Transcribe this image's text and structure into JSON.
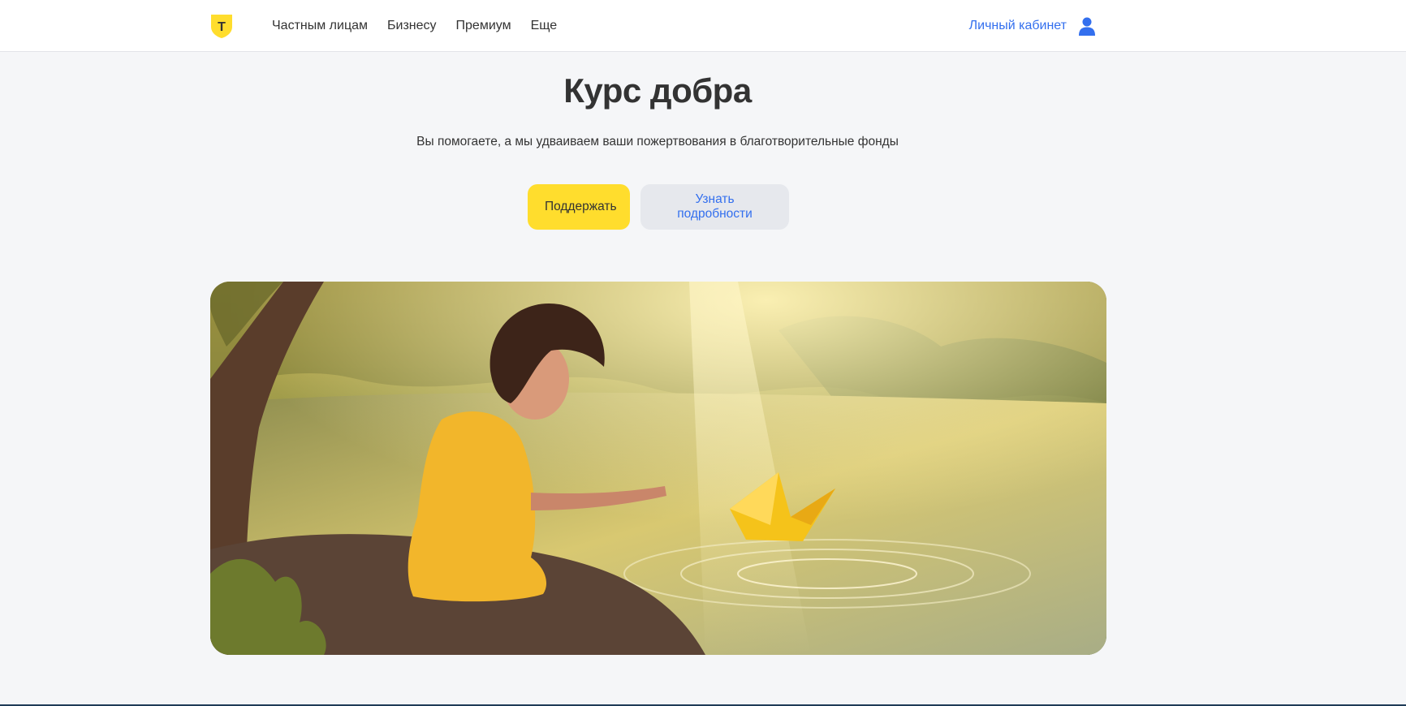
{
  "header": {
    "logo_letter": "Т",
    "nav": [
      {
        "label": "Частным лицам"
      },
      {
        "label": "Бизнесу"
      },
      {
        "label": "Премиум"
      },
      {
        "label": "Еще"
      }
    ],
    "cabinet_label": "Личный кабинет",
    "cabinet_icon": "user-icon"
  },
  "hero": {
    "title": "Курс добра",
    "subtitle": "Вы помогаете, а мы удваиваем ваши пожертвования в благотворительные фонды",
    "primary_button": "Поддержать",
    "secondary_button": "Узнать подробности",
    "image_icon": "girl-with-origami-crane-illustration"
  },
  "colors": {
    "accent_yellow": "#ffdd2d",
    "link_blue": "#336fee",
    "page_bg": "#f5f6f8"
  }
}
